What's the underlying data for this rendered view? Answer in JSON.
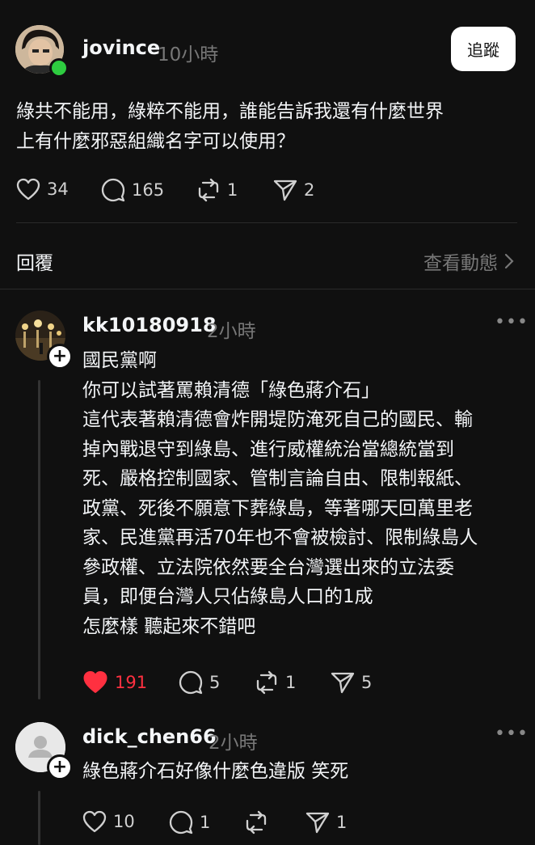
{
  "post": {
    "author": "jovince",
    "time": "10小時",
    "follow_label": "追蹤",
    "text": "綠共不能用，綠粹不能用，誰能告訴我還有什麼世界\n上有什麼邪惡組織名字可以使用？",
    "likes": "34",
    "comments": "165",
    "reposts": "1",
    "shares": "2"
  },
  "replies_header": {
    "label": "回覆",
    "activity_label": "查看動態"
  },
  "replies": [
    {
      "author": "kk10180918",
      "time": "2小時",
      "text": "國民黨啊\n你可以試著罵賴清德「綠色蔣介石」\n這代表著賴清德會炸開堤防淹死自己的國民、輸\n掉內戰退守到綠島、進行威權統治當總統當到\n死、嚴格控制國家、管制言論自由、限制報紙、\n政黨、死後不願意下葬綠島，等著哪天回萬里老\n家、民進黨再活70年也不會被檢討、限制綠島人\n參政權、立法院依然要全台灣選出來的立法委\n員，即便台灣人只佔綠島人口的1成\n怎麼樣 聽起來不錯吧",
      "likes": "191",
      "comments": "5",
      "reposts": "1",
      "shares": "5",
      "liked": true
    },
    {
      "author": "dick_chen66",
      "time": "2小時",
      "text": "綠色蔣介石好像什麼色違版 笑死",
      "likes": "10",
      "comments": "1",
      "reposts": "",
      "shares": "1",
      "liked": false
    }
  ],
  "colors": {
    "background": "#101010",
    "text": "#f3f5f7",
    "muted": "#777777",
    "liked": "#ff3040",
    "online": "#2ecc40"
  },
  "icons": [
    "heart-icon",
    "comment-icon",
    "repost-icon",
    "share-icon",
    "chevron-right-icon",
    "more-icon",
    "plus-icon",
    "person-icon"
  ]
}
